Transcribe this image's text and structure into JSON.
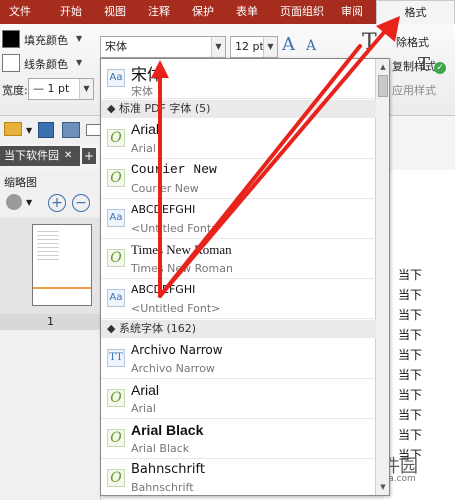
{
  "tabs": [
    "文件",
    "开始",
    "视图",
    "注释",
    "保护",
    "表单",
    "页面组织",
    "审阅",
    "格式"
  ],
  "ribbon": {
    "fill_color": "填充颜色",
    "line_color": "线条颜色",
    "width_label": "宽度:",
    "width_value": "— 1 pt",
    "font_value": "宋体",
    "size_value": "12 pt",
    "grow_icon": "A",
    "shrink_icon": "A",
    "clear_format": "除格式",
    "copy_format": "复制样式",
    "apply_format": "应用样式"
  },
  "doc_tab": "当下软件园",
  "thumbnail": {
    "header": "缩略图",
    "page_number": "1"
  },
  "font_list": {
    "current": {
      "name": "宋体",
      "sub": "宋体",
      "icon": "Aa"
    },
    "group_standard": "◆ 标准 PDF 字体 (5)",
    "standard": [
      {
        "name": "Arial",
        "sub": "Arial",
        "icon": "O"
      },
      {
        "name": "Courier New",
        "sub": "Courier New",
        "icon": "O"
      },
      {
        "name": "ABCDEFGHI",
        "sub": "<Untitled Font>",
        "icon": "Aa"
      },
      {
        "name": "Times New Roman",
        "sub": "Times New Roman",
        "icon": "O"
      },
      {
        "name": "ABCDEFGHI",
        "sub": "<Untitled Font>",
        "icon": "Aa"
      }
    ],
    "group_system": "◆ 系统字体 (162)",
    "system": [
      {
        "name": "Archivo Narrow",
        "sub": "Archivo Narrow",
        "icon": "TT"
      },
      {
        "name": "Arial",
        "sub": "Arial",
        "icon": "O"
      },
      {
        "name": "Arial Black",
        "sub": "Arial Black",
        "icon": "O"
      },
      {
        "name": "Bahnschrift",
        "sub": "Bahnschrift",
        "icon": "O"
      }
    ]
  },
  "document_lines": [
    "当下",
    "当下",
    "当下",
    "当下",
    "当下",
    "当下",
    "当下",
    "当下",
    "当下",
    "当下"
  ],
  "watermark": {
    "title": "当下软件园",
    "url": "www.downxia.com"
  },
  "colors": {
    "brand": "#a62c1e",
    "arrow": "#e8231c"
  }
}
